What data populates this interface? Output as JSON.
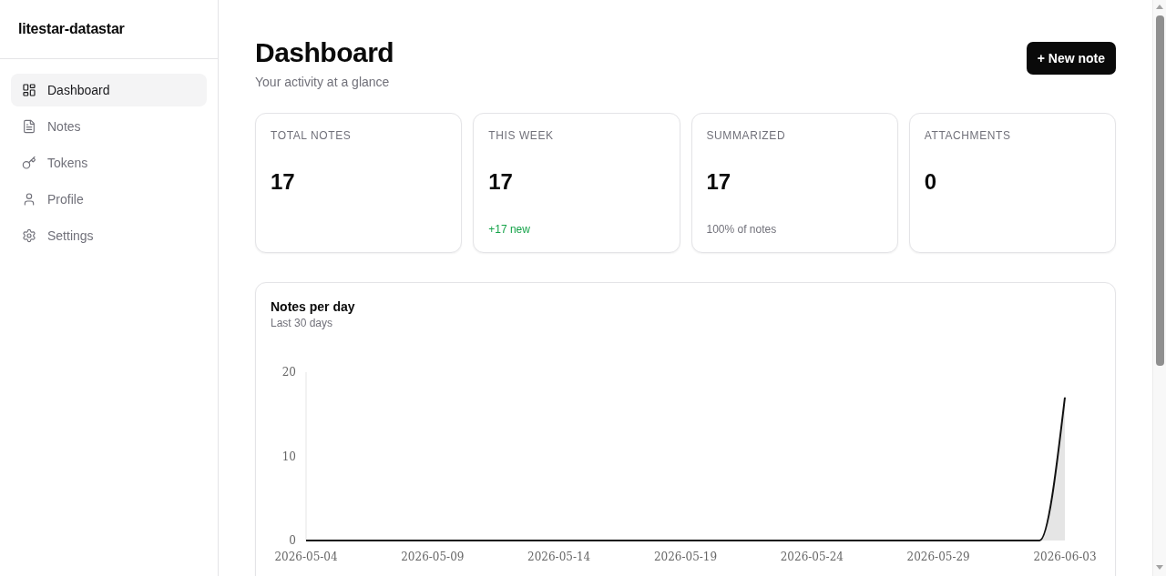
{
  "sidebar": {
    "brand": "litestar-datastar",
    "items": [
      {
        "label": "Dashboard",
        "selected": true
      },
      {
        "label": "Notes",
        "selected": false
      },
      {
        "label": "Tokens",
        "selected": false
      },
      {
        "label": "Profile",
        "selected": false
      },
      {
        "label": "Settings",
        "selected": false
      }
    ]
  },
  "header": {
    "title": "Dashboard",
    "subtitle": "Your activity at a glance",
    "action": "+ New note"
  },
  "stats": [
    {
      "label": "TOTAL NOTES",
      "value": "17"
    },
    {
      "label": "THIS WEEK",
      "value": "17",
      "note": {
        "text": "+17 new",
        "kind": "gain"
      }
    },
    {
      "label": "SUMMARIZED",
      "value": "17",
      "note": {
        "text": "100% of notes",
        "kind": "info"
      }
    },
    {
      "label": "ATTACHMENTS",
      "value": "0"
    }
  ],
  "chart": {
    "title": "Notes per day",
    "subtitle": "Last 30 days",
    "chart_data": {
      "type": "area",
      "categories": [
        "2026-05-04",
        null,
        null,
        null,
        null,
        "2026-05-09",
        null,
        null,
        null,
        null,
        "2026-05-14",
        null,
        null,
        null,
        null,
        "2026-05-19",
        null,
        null,
        null,
        null,
        "2026-05-24",
        null,
        null,
        null,
        null,
        "2026-05-29",
        null,
        null,
        null,
        null,
        "2026-06-03"
      ],
      "values": [
        0,
        0,
        0,
        0,
        0,
        0,
        0,
        0,
        0,
        0,
        0,
        0,
        0,
        0,
        0,
        0,
        0,
        0,
        0,
        0,
        0,
        0,
        0,
        0,
        0,
        0,
        0,
        0,
        0,
        0,
        17
      ],
      "ylim": [
        0,
        20
      ],
      "yticks": [
        0,
        10,
        20
      ]
    }
  }
}
